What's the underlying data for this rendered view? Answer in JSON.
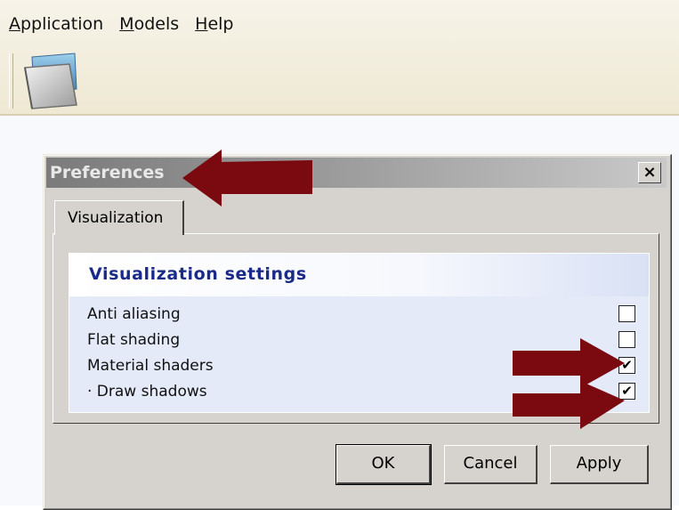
{
  "menubar": {
    "items": [
      {
        "mnemonic": "A",
        "rest": "pplication",
        "label": "Application"
      },
      {
        "mnemonic": "M",
        "rest": "odels",
        "label": "Models"
      },
      {
        "mnemonic": "H",
        "rest": "elp",
        "label": "Help"
      }
    ]
  },
  "toolbar": {
    "icon": "folder-icon"
  },
  "dialog": {
    "title": "Preferences",
    "close_label": "×",
    "tab_label": "Visualization",
    "section_title": "Visualization settings",
    "settings": [
      {
        "label": "Anti aliasing",
        "checked": false
      },
      {
        "label": "Flat shading",
        "checked": false
      },
      {
        "label": "Material shaders",
        "checked": true
      },
      {
        "label": "· Draw shadows",
        "checked": true
      }
    ],
    "buttons": {
      "ok": "OK",
      "cancel": "Cancel",
      "apply": "Apply"
    }
  },
  "annotations": {
    "arrow_color": "#7a0a0f"
  }
}
